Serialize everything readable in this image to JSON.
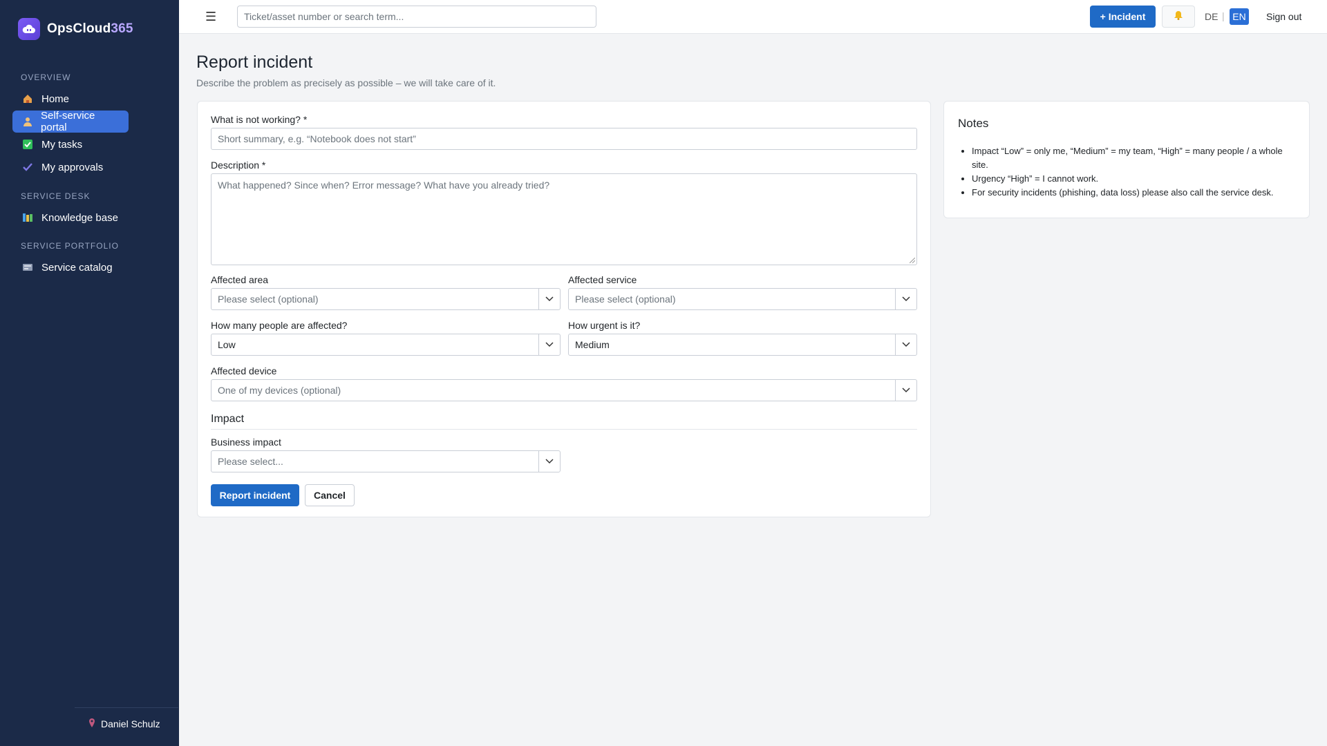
{
  "brand": {
    "name_main": "OpsCloud",
    "name_accent": "365"
  },
  "sidebar": {
    "sections": [
      {
        "label": "OVERVIEW"
      },
      {
        "label": "SERVICE DESK"
      },
      {
        "label": "SERVICE PORTFOLIO"
      }
    ],
    "items": [
      {
        "label": "Home",
        "icon": "home-icon"
      },
      {
        "label": "Self-service portal",
        "icon": "person-icon",
        "active": true
      },
      {
        "label": "My tasks",
        "icon": "check-square-icon"
      },
      {
        "label": "My approvals",
        "icon": "checkmark-icon"
      },
      {
        "label": "Knowledge base",
        "icon": "books-icon"
      },
      {
        "label": "Service catalog",
        "icon": "catalog-icon"
      }
    ],
    "user": "Daniel Schulz"
  },
  "topbar": {
    "search_placeholder": "Ticket/asset number or search term...",
    "incident_button": "+ Incident",
    "lang_de": "DE",
    "lang_sep": "|",
    "lang_en": "EN",
    "sign_out": "Sign out"
  },
  "page": {
    "title": "Report incident",
    "subtitle": "Describe the problem as precisely as possible – we will take care of it."
  },
  "form": {
    "summary_label": "What is not working? *",
    "summary_placeholder": "Short summary, e.g. “Notebook does not start”",
    "description_label": "Description *",
    "description_placeholder": "What happened? Since when? Error message? What have you already tried?",
    "area_label": "Affected area",
    "area_placeholder": "Please select (optional)",
    "service_label": "Affected service",
    "service_placeholder": "Please select (optional)",
    "impact_label": "How many people are affected?",
    "impact_value": "Low",
    "urgency_label": "How urgent is it?",
    "urgency_value": "Medium",
    "device_label": "Affected device",
    "device_placeholder": "One of my devices (optional)",
    "impact_section": "Impact",
    "business_label": "Business impact",
    "business_placeholder": "Please select...",
    "submit": "Report incident",
    "cancel": "Cancel"
  },
  "notes": {
    "title": "Notes",
    "items": [
      "Impact “Low” = only me, “Medium” = my team, “High” = many people / a whole site.",
      "Urgency “High” = I cannot work.",
      "For security incidents (phishing, data loss) please also call the service desk."
    ]
  },
  "colors": {
    "sidebar_bg": "#1b2a48",
    "accent": "#1f6ac6",
    "active_nav": "#3b6fd9"
  }
}
